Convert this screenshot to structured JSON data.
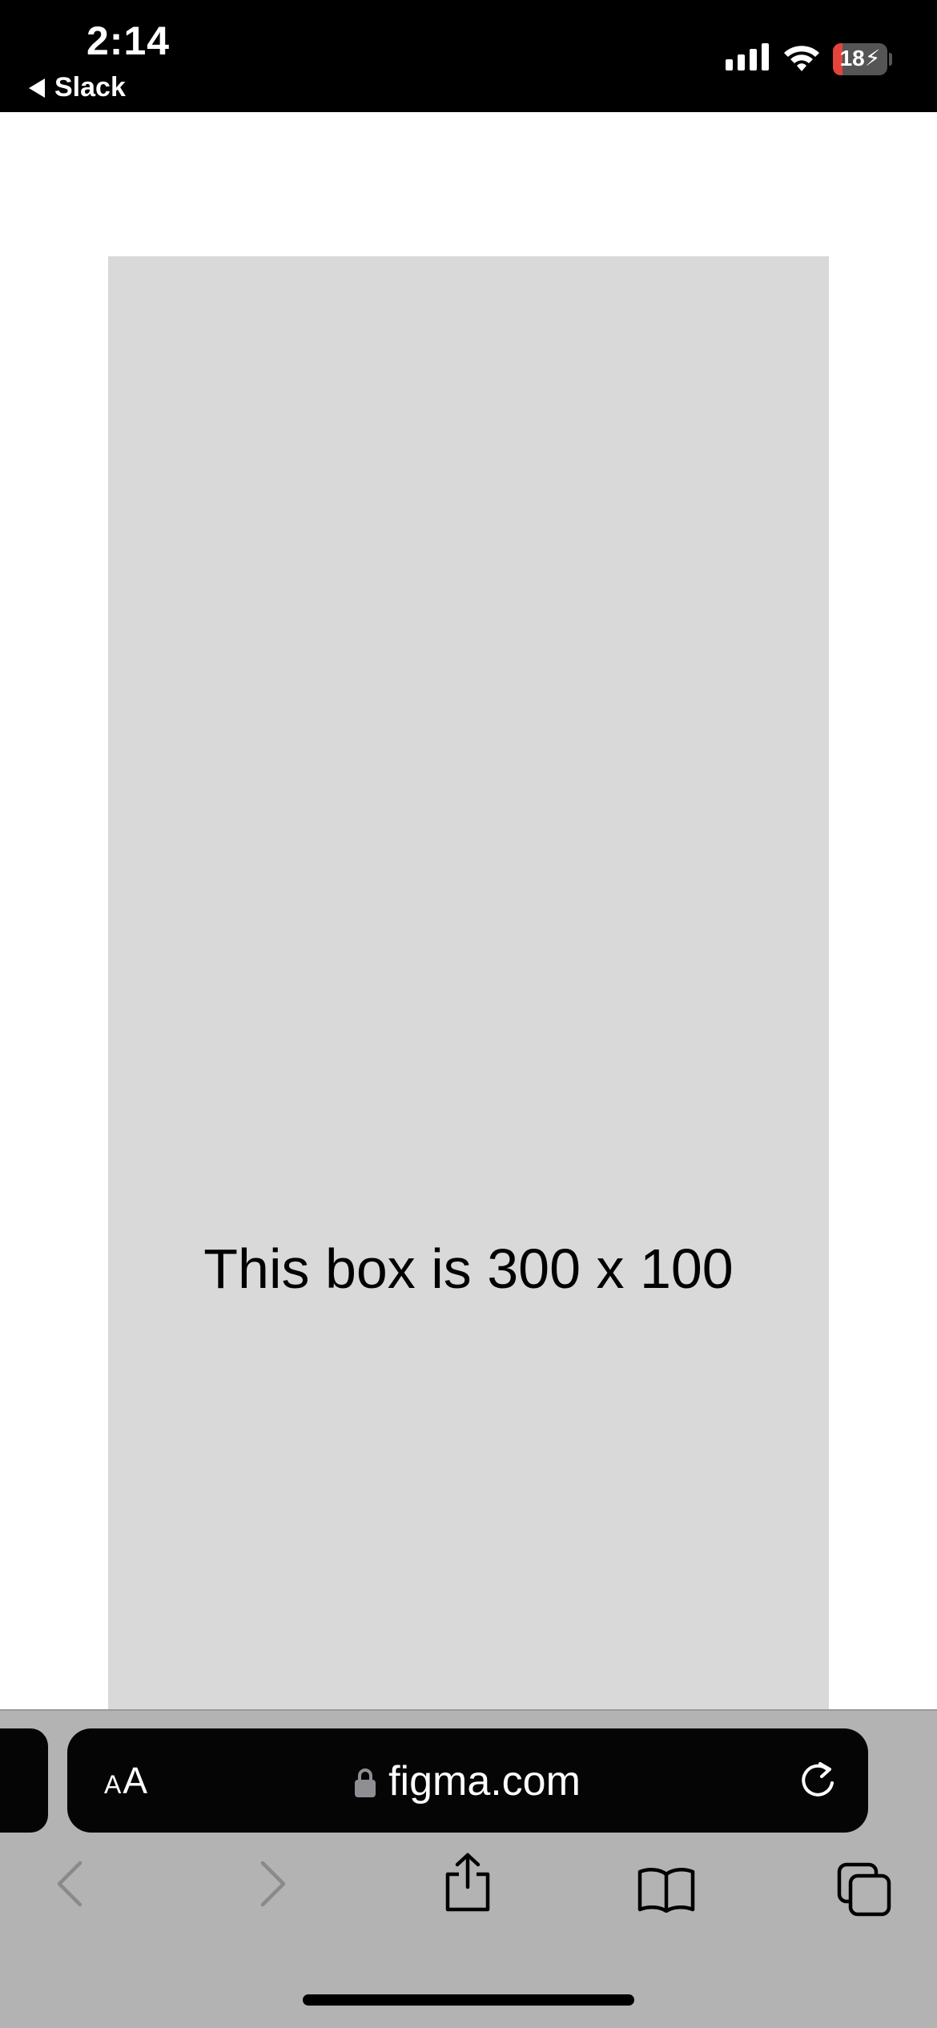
{
  "status_bar": {
    "time": "2:14",
    "back_app": "Slack",
    "battery_level": "18",
    "battery_fraction": 0.18,
    "battery_charging": true
  },
  "page": {
    "box_text": "This box is 300 x 100",
    "box_color": "#d9d9d9"
  },
  "browser": {
    "text_size_label_small": "A",
    "text_size_label_large": "A",
    "url": "figma.com",
    "icons": [
      "lock-icon",
      "reload-icon",
      "back-icon",
      "forward-icon",
      "share-icon",
      "bookmarks-icon",
      "tabs-icon"
    ]
  }
}
